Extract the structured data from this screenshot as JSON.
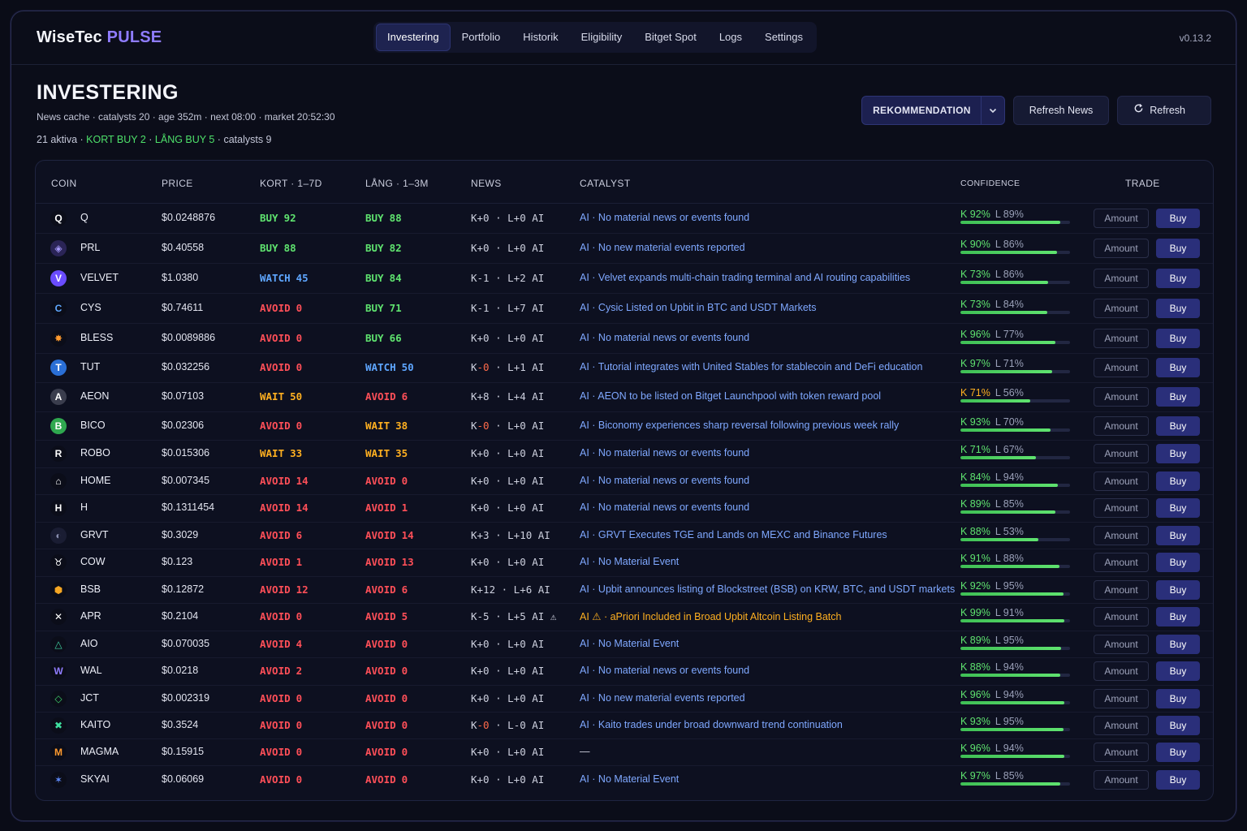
{
  "app": {
    "brand_main": "WiseTec",
    "brand_accent": "PULSE",
    "version": "v0.13.2"
  },
  "nav": [
    {
      "label": "Investering",
      "active": true
    },
    {
      "label": "Portfolio"
    },
    {
      "label": "Historik"
    },
    {
      "label": "Eligibility"
    },
    {
      "label": "Bitget Spot"
    },
    {
      "label": "Logs"
    },
    {
      "label": "Settings"
    }
  ],
  "header": {
    "title": "INVESTERING",
    "subline": "News cache · catalysts 20 · age 352m · next 08:00 · market 20:52:30",
    "stats": {
      "aktiva": "21 aktiva",
      "sep": " · ",
      "kort": "KORT BUY 2",
      "lang": "LÅNG BUY 5",
      "catalysts": "catalysts 9"
    }
  },
  "actions": {
    "mode_select": "REKOMMENDATION",
    "refresh_news": "Refresh News",
    "refresh": "Refresh"
  },
  "table": {
    "headers": {
      "coin": "COIN",
      "price": "PRICE",
      "kort": "KORT · 1–7D",
      "lang": "LÅNG · 1–3M",
      "news": "NEWS",
      "catalyst": "CATALYST",
      "confidence": "CONFIDENCE",
      "trade": "TRADE"
    },
    "amount_placeholder": "Amount",
    "buy_label": "Buy",
    "rows": [
      {
        "coin": "Q",
        "icon": "Q",
        "icon_bg": "#0b0d19",
        "icon_fg": "#ffffff",
        "price": "$0.0248876",
        "kort": [
          "BUY",
          "92"
        ],
        "lang": [
          "BUY",
          "88"
        ],
        "news": "K+0 · L+0 AI",
        "catalyst": "AI · No material news or events found",
        "k": "K 92%",
        "l": "L 89%",
        "kv": 92,
        "lv": 89
      },
      {
        "coin": "PRL",
        "icon": "◈",
        "icon_bg": "#2a2456",
        "icon_fg": "#a79bff",
        "price": "$0.40558",
        "kort": [
          "BUY",
          "88"
        ],
        "lang": [
          "BUY",
          "82"
        ],
        "news": "K+0 · L+0 AI",
        "catalyst": "AI · No new material events reported",
        "k": "K 90%",
        "l": "L 86%",
        "kv": 90,
        "lv": 86
      },
      {
        "coin": "VELVET",
        "icon": "V",
        "icon_bg": "#6a4cff",
        "icon_fg": "#ffffff",
        "price": "$1.0380",
        "kort": [
          "WATCH",
          "45"
        ],
        "lang": [
          "BUY",
          "84"
        ],
        "news": "K-1 · L+2 AI",
        "catalyst": "AI · Velvet expands multi-chain trading terminal and AI routing capabilities",
        "k": "K 73%",
        "l": "L 86%",
        "kv": 73,
        "lv": 86
      },
      {
        "coin": "CYS",
        "icon": "C",
        "icon_bg": "#0b0d19",
        "icon_fg": "#5fa8ff",
        "price": "$0.74611",
        "kort": [
          "AVOID",
          "0"
        ],
        "lang": [
          "BUY",
          "71"
        ],
        "news": "K-1 · L+7 AI",
        "catalyst": "AI · Cysic Listed on Upbit in BTC and USDT Markets",
        "k": "K 73%",
        "l": "L 84%",
        "kv": 73,
        "lv": 84
      },
      {
        "coin": "BLESS",
        "icon": "✸",
        "icon_bg": "#0b0d19",
        "icon_fg": "#ff9a2e",
        "price": "$0.0089886",
        "kort": [
          "AVOID",
          "0"
        ],
        "lang": [
          "BUY",
          "66"
        ],
        "news": "K+0 · L+0 AI",
        "catalyst": "AI · No material news or events found",
        "k": "K 96%",
        "l": "L 77%",
        "kv": 96,
        "lv": 77
      },
      {
        "coin": "TUT",
        "icon": "T",
        "icon_bg": "#2a6fd6",
        "icon_fg": "#ffffff",
        "price": "$0.032256",
        "kort": [
          "AVOID",
          "0"
        ],
        "lang": [
          "WATCH",
          "50"
        ],
        "news": "K-0 · L+1 AI",
        "catalyst": "AI · Tutorial integrates with United Stables for stablecoin and DeFi education",
        "k": "K 97%",
        "l": "L 71%",
        "kv": 97,
        "lv": 71
      },
      {
        "coin": "AEON",
        "icon": "A",
        "icon_bg": "#3a3d4d",
        "icon_fg": "#ffffff",
        "price": "$0.07103",
        "kort": [
          "WAIT",
          "50"
        ],
        "lang": [
          "AVOID",
          "6"
        ],
        "news": "K+8 · L+4 AI",
        "catalyst": "AI · AEON to be listed on Bitget Launchpool with token reward pool",
        "k": "K 71%",
        "l": "L 56%",
        "kv": 71,
        "lv": 56,
        "kmid": true
      },
      {
        "coin": "BICO",
        "icon": "B",
        "icon_bg": "#2fa84f",
        "icon_fg": "#ffffff",
        "price": "$0.02306",
        "kort": [
          "AVOID",
          "0"
        ],
        "lang": [
          "WAIT",
          "38"
        ],
        "news": "K-0 · L+0 AI",
        "catalyst": "AI · Biconomy experiences sharp reversal following previous week rally",
        "k": "K 93%",
        "l": "L 70%",
        "kv": 93,
        "lv": 70
      },
      {
        "coin": "ROBO",
        "icon": "R",
        "icon_bg": "#0b0d19",
        "icon_fg": "#ffffff",
        "price": "$0.015306",
        "kort": [
          "WAIT",
          "33"
        ],
        "lang": [
          "WAIT",
          "35"
        ],
        "news": "K+0 · L+0 AI",
        "catalyst": "AI · No material news or events found",
        "k": "K 71%",
        "l": "L 67%",
        "kv": 71,
        "lv": 67
      },
      {
        "coin": "HOME",
        "icon": "⌂",
        "icon_bg": "#0b0d19",
        "icon_fg": "#ffffff",
        "price": "$0.007345",
        "kort": [
          "AVOID",
          "14"
        ],
        "lang": [
          "AVOID",
          "0"
        ],
        "news": "K+0 · L+0 AI",
        "catalyst": "AI · No material news or events found",
        "k": "K 84%",
        "l": "L 94%",
        "kv": 84,
        "lv": 94
      },
      {
        "coin": "H",
        "icon": "H",
        "icon_bg": "#0b0d19",
        "icon_fg": "#ffffff",
        "price": "$0.1311454",
        "kort": [
          "AVOID",
          "14"
        ],
        "lang": [
          "AVOID",
          "1"
        ],
        "news": "K+0 · L+0 AI",
        "catalyst": "AI · No material news or events found",
        "k": "K 89%",
        "l": "L 85%",
        "kv": 89,
        "lv": 85
      },
      {
        "coin": "GRVT",
        "icon": "◐",
        "icon_bg": "#1a1d33",
        "icon_fg": "#8a8fb0",
        "price": "$0.3029",
        "kort": [
          "AVOID",
          "6"
        ],
        "lang": [
          "AVOID",
          "14"
        ],
        "news": "K+3 · L+10 AI",
        "catalyst": "AI · GRVT Executes TGE and Lands on MEXC and Binance Futures",
        "k": "K 88%",
        "l": "L 53%",
        "kv": 88,
        "lv": 53
      },
      {
        "coin": "COW",
        "icon": "♉",
        "icon_bg": "#0b0d19",
        "icon_fg": "#ffffff",
        "price": "$0.123",
        "kort": [
          "AVOID",
          "1"
        ],
        "lang": [
          "AVOID",
          "13"
        ],
        "news": "K+0 · L+0 AI",
        "catalyst": "AI · No Material Event",
        "k": "K 91%",
        "l": "L 88%",
        "kv": 91,
        "lv": 88
      },
      {
        "coin": "BSB",
        "icon": "⬢",
        "icon_bg": "#0b0d19",
        "icon_fg": "#f5a623",
        "price": "$0.12872",
        "kort": [
          "AVOID",
          "12"
        ],
        "lang": [
          "AVOID",
          "6"
        ],
        "news": "K+12 · L+6 AI",
        "catalyst": "AI · Upbit announces listing of Blockstreet (BSB) on KRW, BTC, and USDT markets",
        "k": "K 92%",
        "l": "L 95%",
        "kv": 92,
        "lv": 95
      },
      {
        "coin": "APR",
        "icon": "✕",
        "icon_bg": "#0b0d19",
        "icon_fg": "#ffffff",
        "price": "$0.2104",
        "kort": [
          "AVOID",
          "0"
        ],
        "lang": [
          "AVOID",
          "5"
        ],
        "news": "K-5 · L+5 AI ⚠",
        "catalyst": "AI ⚠ · aPriori Included in Broad Upbit Altcoin Listing Batch",
        "k": "K 99%",
        "l": "L 91%",
        "kv": 99,
        "lv": 91,
        "warn": true
      },
      {
        "coin": "AIO",
        "icon": "△",
        "icon_bg": "#0b0d19",
        "icon_fg": "#3fd0a0",
        "price": "$0.070035",
        "kort": [
          "AVOID",
          "4"
        ],
        "lang": [
          "AVOID",
          "0"
        ],
        "news": "K+0 · L+0 AI",
        "catalyst": "AI · No Material Event",
        "k": "K 89%",
        "l": "L 95%",
        "kv": 89,
        "lv": 95
      },
      {
        "coin": "WAL",
        "icon": "W",
        "icon_bg": "#0b0d19",
        "icon_fg": "#8f7cff",
        "price": "$0.0218",
        "kort": [
          "AVOID",
          "2"
        ],
        "lang": [
          "AVOID",
          "0"
        ],
        "news": "K+0 · L+0 AI",
        "catalyst": "AI · No material news or events found",
        "k": "K 88%",
        "l": "L 94%",
        "kv": 88,
        "lv": 94
      },
      {
        "coin": "JCT",
        "icon": "◇",
        "icon_bg": "#0b0d19",
        "icon_fg": "#3fd06a",
        "price": "$0.002319",
        "kort": [
          "AVOID",
          "0"
        ],
        "lang": [
          "AVOID",
          "0"
        ],
        "news": "K+0 · L+0 AI",
        "catalyst": "AI · No new material events reported",
        "k": "K 96%",
        "l": "L 94%",
        "kv": 96,
        "lv": 94
      },
      {
        "coin": "KAITO",
        "icon": "✖",
        "icon_bg": "#0b0d19",
        "icon_fg": "#3fe0a0",
        "price": "$0.3524",
        "kort": [
          "AVOID",
          "0"
        ],
        "lang": [
          "AVOID",
          "0"
        ],
        "news": "K-0 · L-0 AI",
        "catalyst": "AI · Kaito trades under broad downward trend continuation",
        "k": "K 93%",
        "l": "L 95%",
        "kv": 93,
        "lv": 95
      },
      {
        "coin": "MAGMA",
        "icon": "M",
        "icon_bg": "#0b0d19",
        "icon_fg": "#ff9a2e",
        "price": "$0.15915",
        "kort": [
          "AVOID",
          "0"
        ],
        "lang": [
          "AVOID",
          "0"
        ],
        "news": "K+0 · L+0 AI",
        "catalyst": "—",
        "k": "K 96%",
        "l": "L 94%",
        "kv": 96,
        "lv": 94,
        "none": true
      },
      {
        "coin": "SKYAI",
        "icon": "✶",
        "icon_bg": "#0b0d19",
        "icon_fg": "#5f8cff",
        "price": "$0.06069",
        "kort": [
          "AVOID",
          "0"
        ],
        "lang": [
          "AVOID",
          "0"
        ],
        "news": "K+0 · L+0 AI",
        "catalyst": "AI · No Material Event",
        "k": "K 97%",
        "l": "L 85%",
        "kv": 97,
        "lv": 85
      }
    ]
  }
}
